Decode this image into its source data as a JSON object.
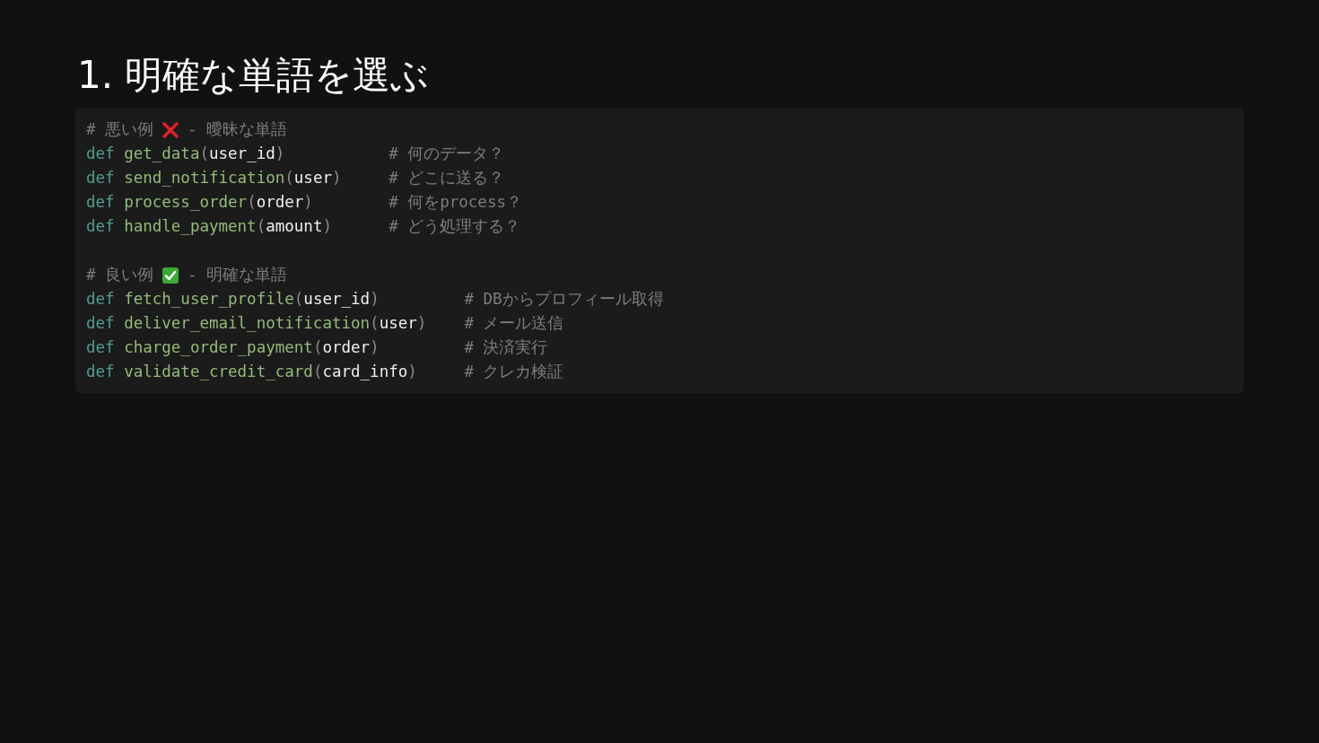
{
  "title": "1. 明確な単語を選ぶ",
  "sections": [
    {
      "kind": "cross",
      "heading_label": "# 悪い例",
      "heading_note": "- 曖昧な単語",
      "lines": [
        {
          "code": "def get_data(user_id)",
          "comment": "# 何のデータ？"
        },
        {
          "code": "def send_notification(user)",
          "comment": "# どこに送る？"
        },
        {
          "code": "def process_order(order)",
          "comment": "# 何をprocess？"
        },
        {
          "code": "def handle_payment(amount)",
          "comment": "# どう処理する？"
        }
      ]
    },
    {
      "kind": "check",
      "heading_label": "# 良い例",
      "heading_note": "- 明確な単語",
      "lines": [
        {
          "code": "def fetch_user_profile(user_id)",
          "comment": "# DBからプロフィール取得"
        },
        {
          "code": "def deliver_email_notification(user)",
          "comment": "# メール送信"
        },
        {
          "code": "def charge_order_payment(order)",
          "comment": "# 決済実行"
        },
        {
          "code": "def validate_credit_card(card_info)",
          "comment": "# クレカ検証"
        }
      ]
    }
  ]
}
